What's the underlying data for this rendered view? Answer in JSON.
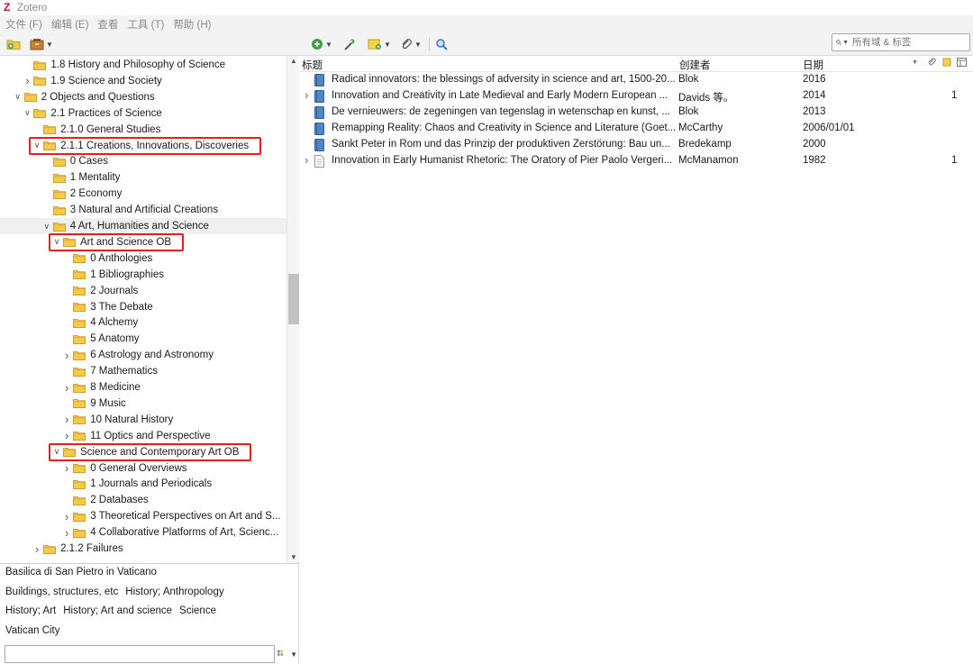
{
  "window": {
    "title": "Zotero"
  },
  "menu": [
    "文件 (F)",
    "编辑 (E)",
    "查看",
    "工具 (T)",
    "帮助 (H)"
  ],
  "search": {
    "placeholder": "所有域 & 标签"
  },
  "collections": [
    {
      "label": "1.8 History and Philosophy of Science",
      "indent": 2,
      "twisty": ""
    },
    {
      "label": "1.9 Science and Society",
      "indent": 2,
      "twisty": "closed"
    },
    {
      "label": "2 Objects and Questions",
      "indent": 1,
      "twisty": "open"
    },
    {
      "label": "2.1 Practices of Science",
      "indent": 2,
      "twisty": "open"
    },
    {
      "label": "2.1.0 General Studies",
      "indent": 3,
      "twisty": ""
    },
    {
      "label": "2.1.1 Creations, Innovations, Discoveries",
      "indent": 3,
      "twisty": "open",
      "highlight": true
    },
    {
      "label": "0 Cases",
      "indent": 4,
      "twisty": ""
    },
    {
      "label": "1 Mentality",
      "indent": 4,
      "twisty": ""
    },
    {
      "label": "2 Economy",
      "indent": 4,
      "twisty": ""
    },
    {
      "label": "3 Natural and Artificial Creations",
      "indent": 4,
      "twisty": ""
    },
    {
      "label": "4 Art, Humanities and Science",
      "indent": 4,
      "twisty": "open",
      "selected": true
    },
    {
      "label": "Art and Science OB",
      "indent": 5,
      "twisty": "open",
      "highlight": true
    },
    {
      "label": "0 Anthologies",
      "indent": 6,
      "twisty": ""
    },
    {
      "label": "1 Bibliographies",
      "indent": 6,
      "twisty": ""
    },
    {
      "label": "2 Journals",
      "indent": 6,
      "twisty": ""
    },
    {
      "label": "3 The Debate",
      "indent": 6,
      "twisty": ""
    },
    {
      "label": "4 Alchemy",
      "indent": 6,
      "twisty": ""
    },
    {
      "label": "5 Anatomy",
      "indent": 6,
      "twisty": ""
    },
    {
      "label": "6 Astrology and Astronomy",
      "indent": 6,
      "twisty": "closed"
    },
    {
      "label": "7 Mathematics",
      "indent": 6,
      "twisty": ""
    },
    {
      "label": "8 Medicine",
      "indent": 6,
      "twisty": "closed"
    },
    {
      "label": "9 Music",
      "indent": 6,
      "twisty": ""
    },
    {
      "label": "10 Natural History",
      "indent": 6,
      "twisty": "closed"
    },
    {
      "label": "11 Optics and Perspective",
      "indent": 6,
      "twisty": "closed"
    },
    {
      "label": "Science and Contemporary Art OB",
      "indent": 5,
      "twisty": "open",
      "highlight": true
    },
    {
      "label": "0 General Overviews",
      "indent": 6,
      "twisty": "closed"
    },
    {
      "label": "1 Journals and Periodicals",
      "indent": 6,
      "twisty": ""
    },
    {
      "label": "2 Databases",
      "indent": 6,
      "twisty": ""
    },
    {
      "label": "3 Theoretical Perspectives on Art and S...",
      "indent": 6,
      "twisty": "closed"
    },
    {
      "label": "4 Collaborative Platforms of Art, Scienc...",
      "indent": 6,
      "twisty": "closed"
    },
    {
      "label": "2.1.2 Failures",
      "indent": 3,
      "twisty": "closed"
    }
  ],
  "tags": {
    "lines": [
      [
        "Basilica di San Pietro in Vaticano"
      ],
      [
        "Buildings, structures, etc",
        "History; Anthropology"
      ],
      [
        "History; Art",
        "History; Art and science",
        "Science"
      ],
      [
        "Vatican City"
      ]
    ]
  },
  "columns": {
    "title": "标题",
    "creator": "创建者",
    "date": "日期"
  },
  "items": [
    {
      "type": "book",
      "twisty": "",
      "title": "Radical innovators: the blessings of adversity in science and art, 1500-20...",
      "creator": "Blok",
      "date": "2016",
      "count": ""
    },
    {
      "type": "book",
      "twisty": "closed",
      "title": "Innovation and Creativity in Late Medieval and Early Modern European ...",
      "creator": "Davids 等。",
      "date": "2014",
      "count": "1"
    },
    {
      "type": "book",
      "twisty": "",
      "title": "De vernieuwers: de zegeningen van tegenslag in wetenschap en kunst, ...",
      "creator": "Blok",
      "date": "2013",
      "count": ""
    },
    {
      "type": "book",
      "twisty": "",
      "title": "Remapping Reality: Chaos and Creativity in Science and Literature (Goet...",
      "creator": "McCarthy",
      "date": "2006/01/01",
      "count": ""
    },
    {
      "type": "book",
      "twisty": "",
      "title": "Sankt Peter in Rom und das Prinzip der produktiven Zerstörung: Bau un...",
      "creator": "Bredekamp",
      "date": "2000",
      "count": ""
    },
    {
      "type": "article",
      "twisty": "closed",
      "title": "Innovation in Early Humanist Rhetoric: The Oratory of Pier Paolo Vergeri...",
      "creator": "McManamon",
      "date": "1982",
      "count": "1"
    }
  ]
}
